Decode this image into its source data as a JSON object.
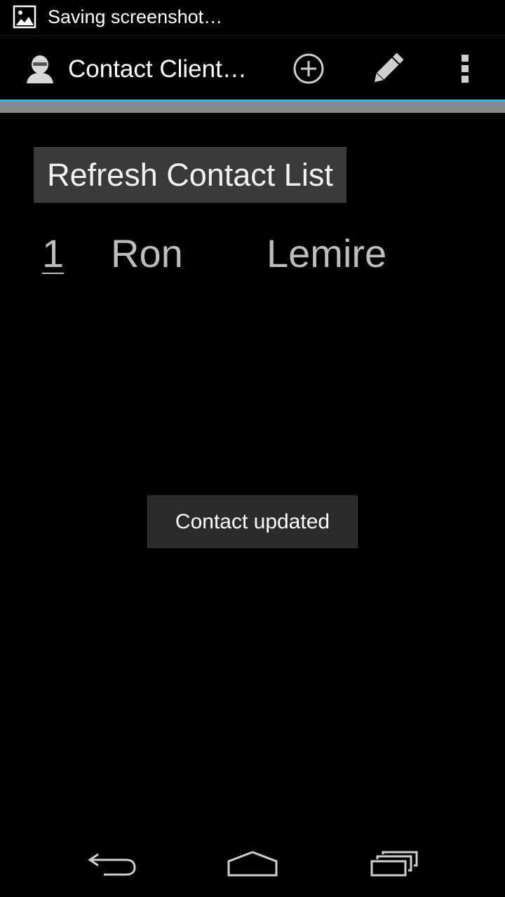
{
  "status_bar": {
    "notification_text": "Saving screenshot…",
    "notification_icon": "image-icon"
  },
  "action_bar": {
    "app_icon": "contact-avatar-icon",
    "title": "Contact Client…",
    "actions": [
      {
        "name": "add",
        "icon": "add-circle-icon"
      },
      {
        "name": "edit",
        "icon": "pencil-icon"
      },
      {
        "name": "overflow",
        "icon": "overflow-menu-icon"
      }
    ]
  },
  "colors": {
    "accent": "#33b5e5",
    "background": "#000000",
    "list_text": "#bdbdbd"
  },
  "main": {
    "refresh_label": "Refresh Contact List",
    "contacts": [
      {
        "id": "1",
        "first_name": "Ron",
        "last_name": "Lemire"
      }
    ]
  },
  "toast": {
    "message": "Contact updated"
  },
  "nav_bar": {
    "buttons": [
      "back-icon",
      "home-icon",
      "recents-icon"
    ]
  }
}
